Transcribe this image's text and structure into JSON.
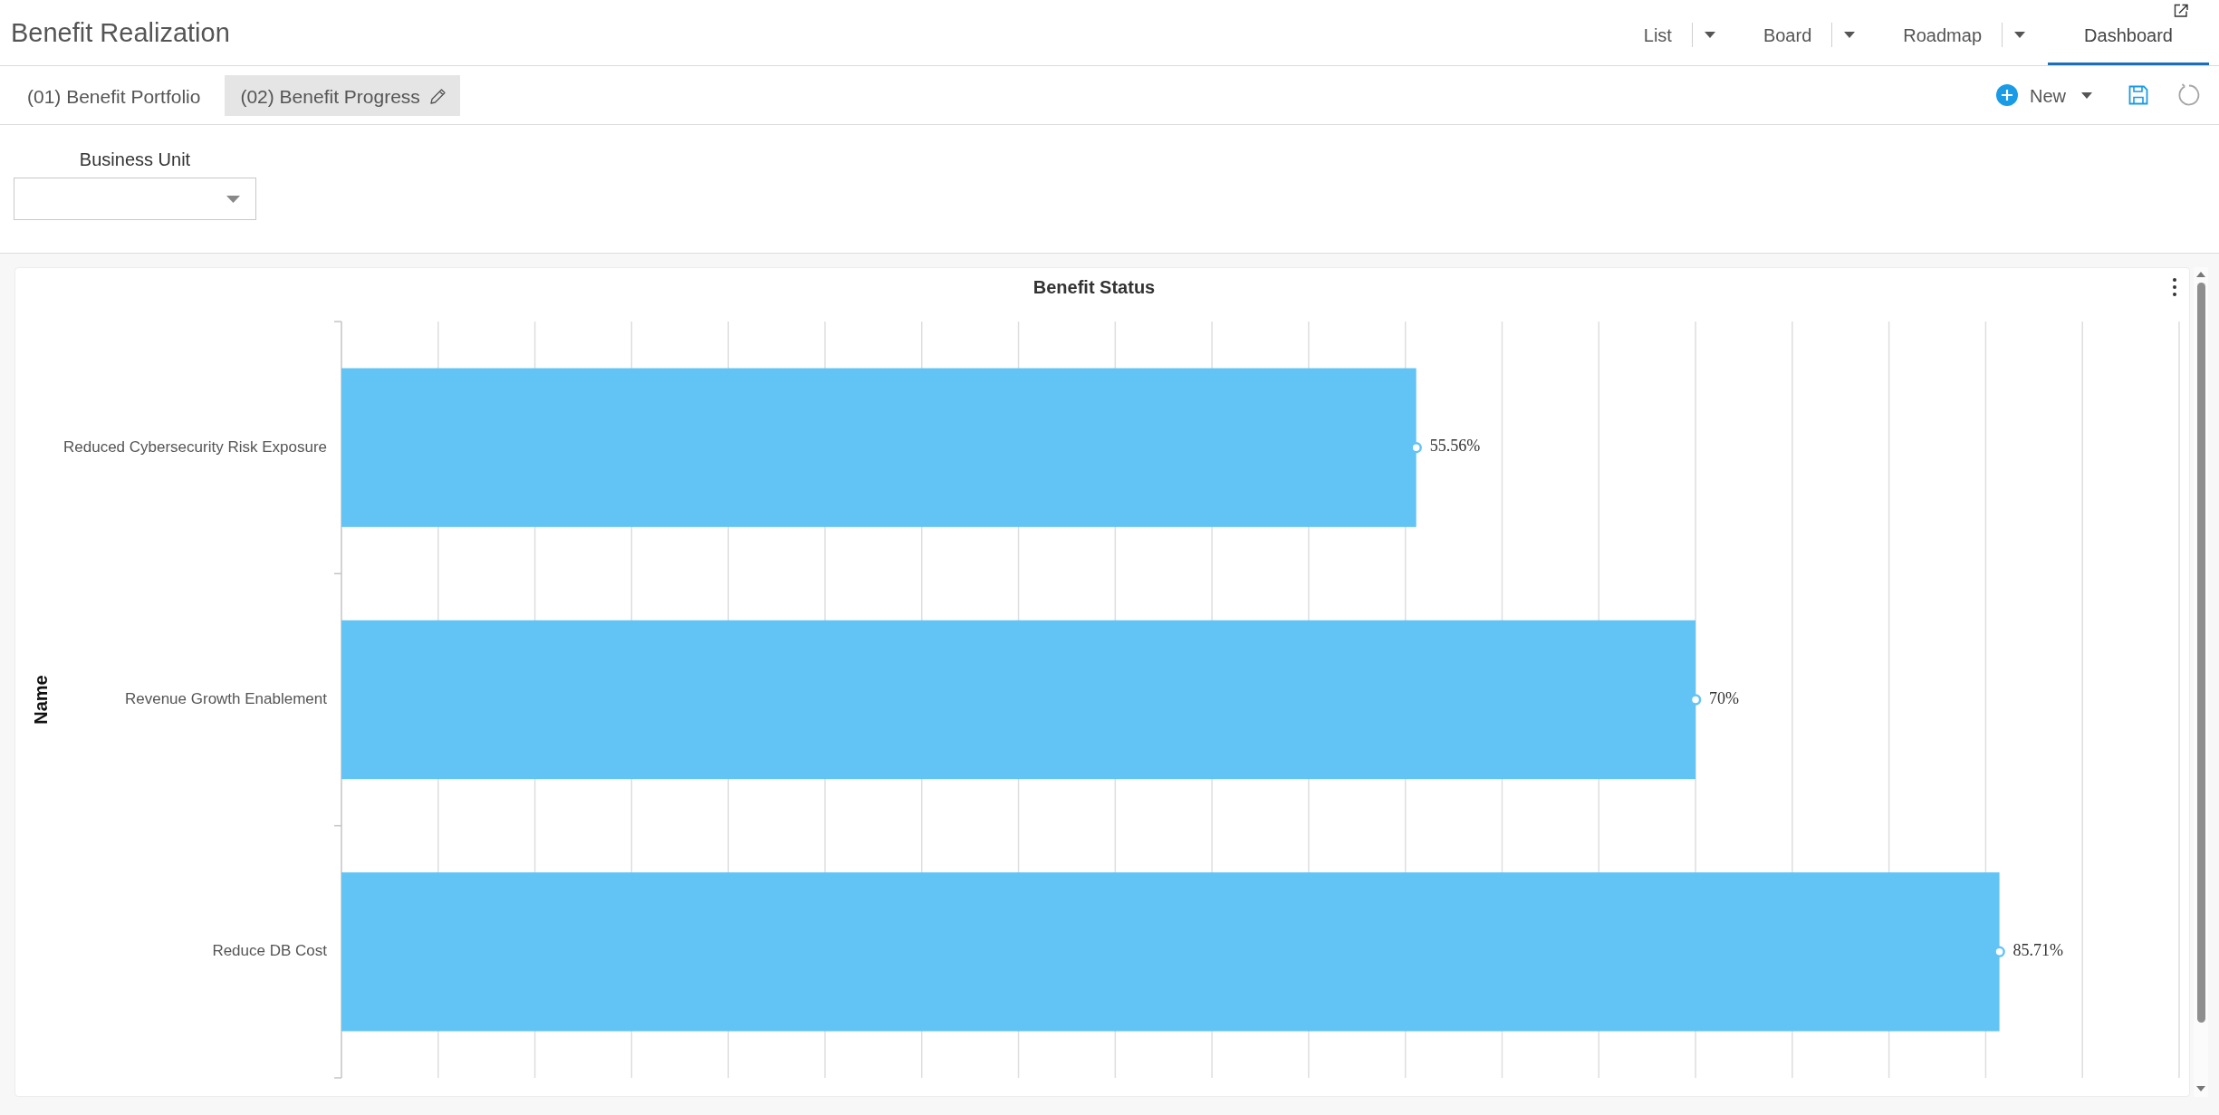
{
  "app": {
    "title": "Benefit Realization"
  },
  "view_tabs": [
    {
      "label": "List",
      "selected": false,
      "dropdown": true
    },
    {
      "label": "Board",
      "selected": false,
      "dropdown": true
    },
    {
      "label": "Roadmap",
      "selected": false,
      "dropdown": true
    },
    {
      "label": "Dashboard",
      "selected": true,
      "dropdown": false
    }
  ],
  "dashboard_tabs": [
    {
      "label": "(01) Benefit Portfolio",
      "selected": false
    },
    {
      "label": "(02) Benefit Progress",
      "selected": true
    }
  ],
  "toolbar": {
    "new_button": "New"
  },
  "filters": [
    {
      "label": "Business Unit"
    }
  ],
  "chart": {
    "chart_data": {
      "type": "bar",
      "orientation": "horizontal",
      "title": "Benefit Status",
      "ylabel": "Name",
      "categories": [
        "Reduced Cybersecurity Risk Exposure",
        "Revenue Growth Enablement",
        "Reduce DB Cost"
      ],
      "values": [
        55.56,
        70,
        85.71
      ],
      "value_labels": [
        "55.56%",
        "70%",
        "85.71%"
      ]
    }
  }
}
